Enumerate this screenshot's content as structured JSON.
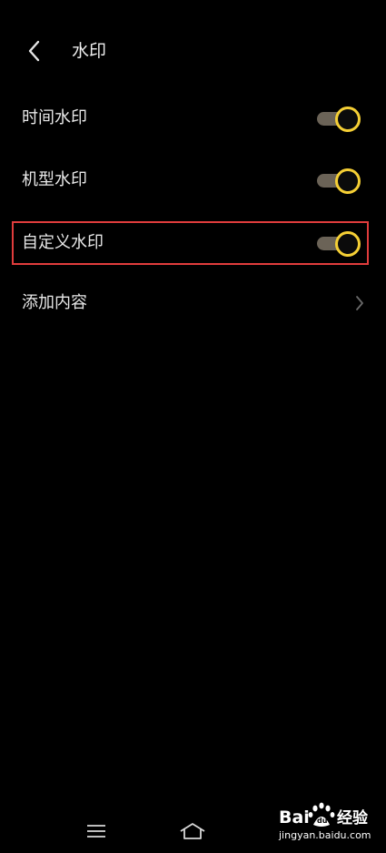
{
  "header": {
    "title": "水印"
  },
  "settings": [
    {
      "label": "时间水印",
      "control": "toggle",
      "enabled": true
    },
    {
      "label": "机型水印",
      "control": "toggle",
      "enabled": true
    },
    {
      "label": "自定义水印",
      "control": "toggle",
      "enabled": true
    },
    {
      "label": "添加内容",
      "control": "chevron"
    }
  ],
  "colors": {
    "background": "#000000",
    "toggle_track": "#6b6357",
    "toggle_knob_ring": "#f5cf35",
    "highlight_border": "#e03c3c",
    "text": "#e8e8e8"
  },
  "icons": {
    "back": "chevron-left-icon",
    "row_arrow": "chevron-right-icon",
    "nav_menu": "menu-icon",
    "nav_home": "home-icon"
  },
  "watermark": {
    "logo_text": "Bai 经验",
    "url": "jingyan.baidu.com"
  }
}
